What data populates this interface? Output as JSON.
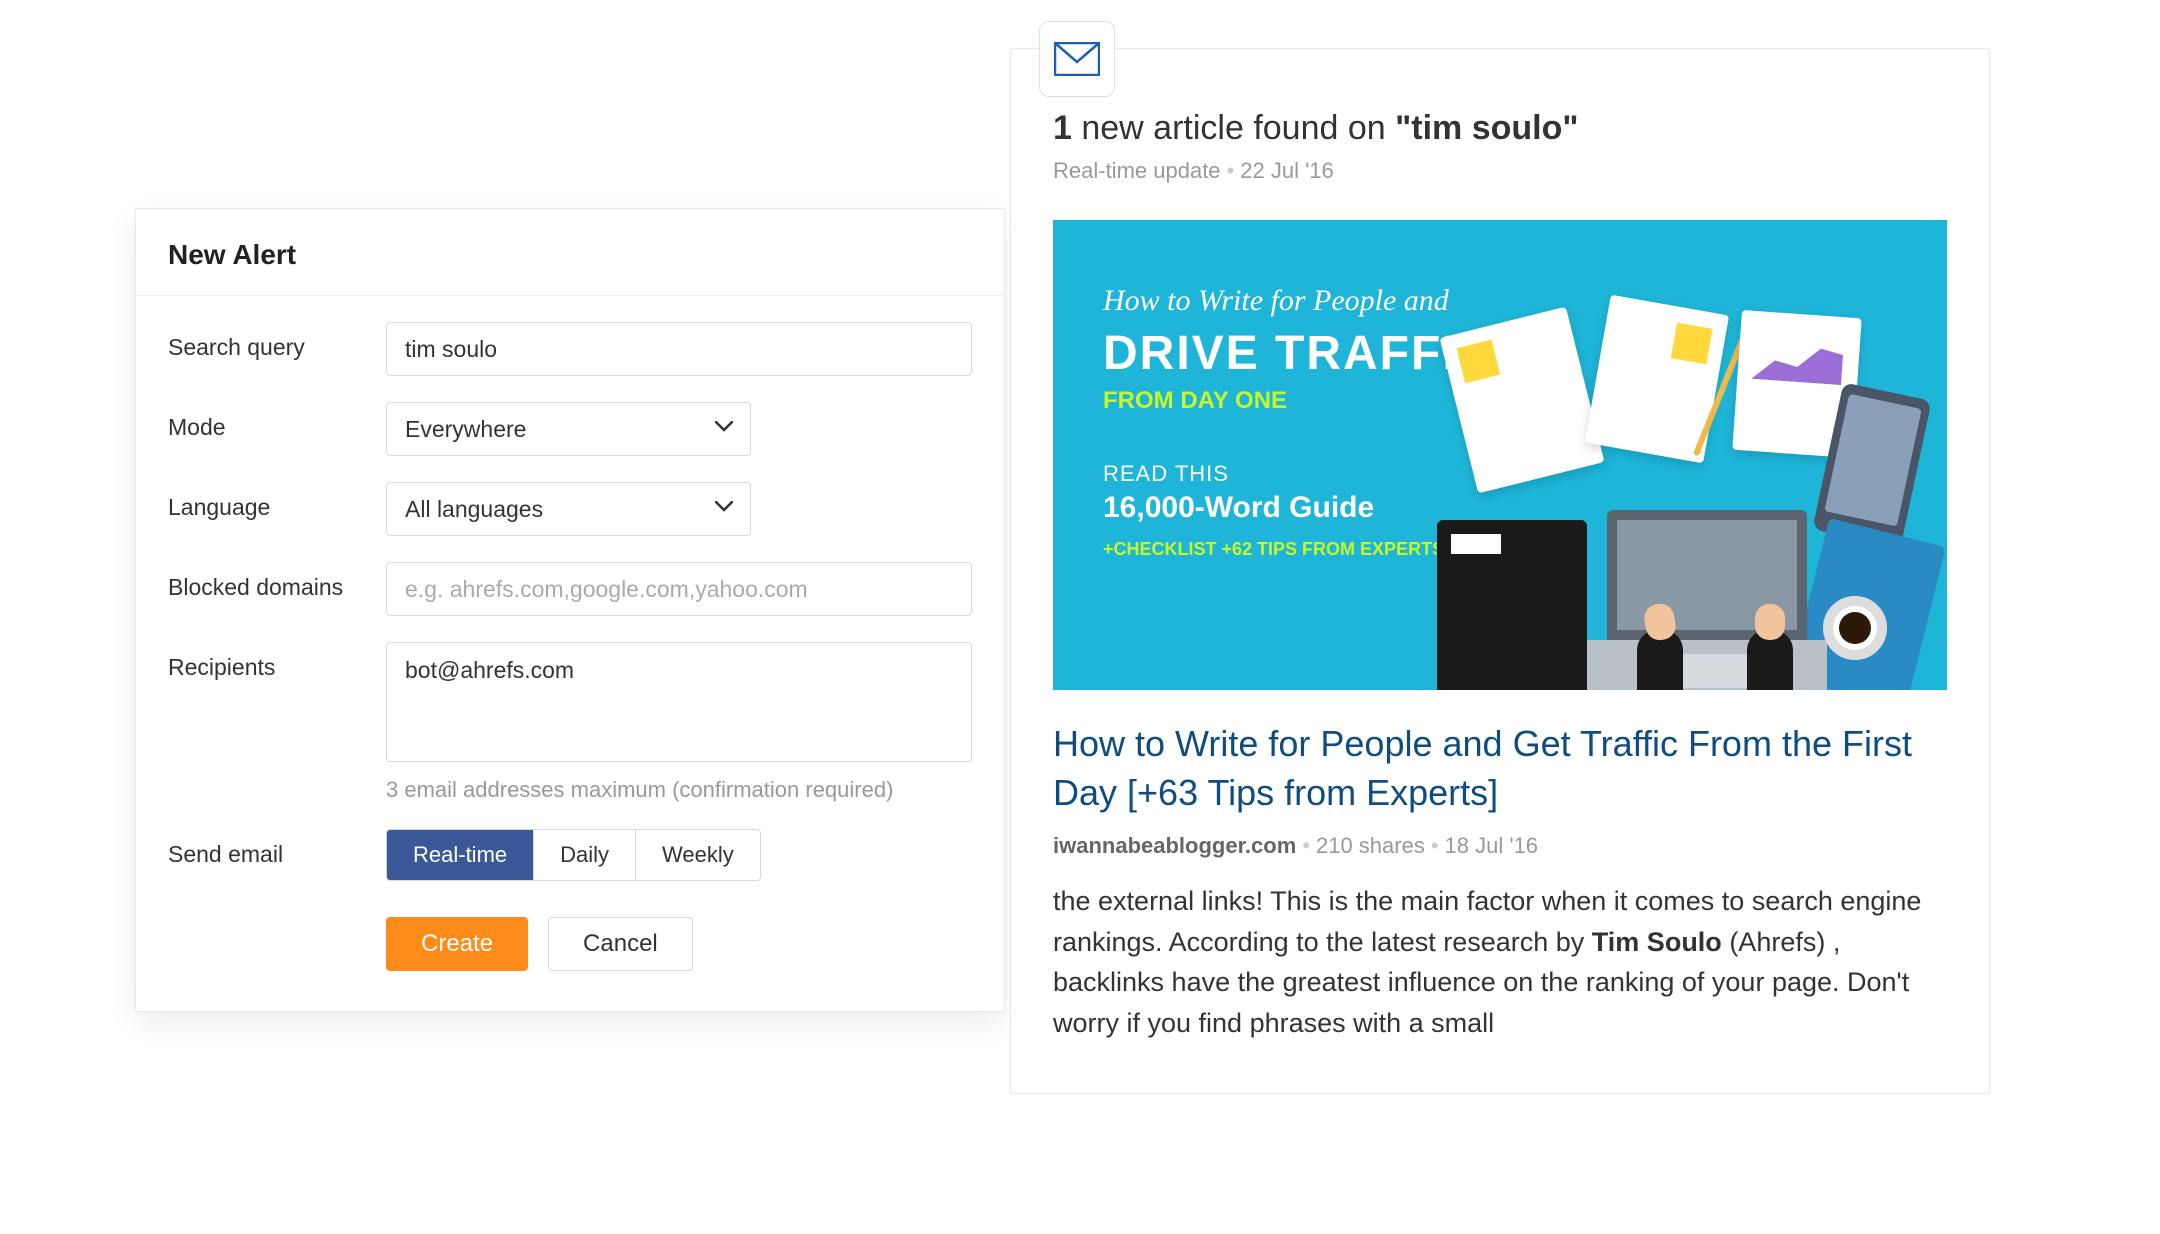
{
  "form": {
    "title": "New Alert",
    "labels": {
      "search_query": "Search query",
      "mode": "Mode",
      "language": "Language",
      "blocked_domains": "Blocked domains",
      "recipients": "Recipients",
      "send_email": "Send email"
    },
    "values": {
      "search_query": "tim soulo",
      "mode": "Everywhere",
      "language": "All languages",
      "blocked_domains": "",
      "recipients": "bot@ahrefs.com"
    },
    "placeholders": {
      "blocked_domains": "e.g. ahrefs.com,google.com,yahoo.com"
    },
    "recipients_helper": "3 email addresses maximum (confirmation required)",
    "send_email_options": {
      "realtime": "Real-time",
      "daily": "Daily",
      "weekly": "Weekly"
    },
    "send_email_selected": "realtime",
    "buttons": {
      "create": "Create",
      "cancel": "Cancel"
    }
  },
  "email": {
    "count": "1",
    "title_middle": " new article found on ",
    "query_display": "\"tim soulo\"",
    "subtitle_type": "Real-time update",
    "subtitle_date": "22 Jul '16",
    "hero": {
      "script": "How to Write for People and",
      "drive": "DRIVE TRAFFIC",
      "fromday": "FROM DAY ONE",
      "read": "READ THIS",
      "guide": "16,000-Word Guide",
      "checklist": "+CHECKLIST +62 TIPS FROM EXPERTS"
    },
    "article": {
      "title": "How to Write for People and Get Traffic From the First Day [+63 Tips from Experts]",
      "domain": "iwannabeablogger.com",
      "shares": "210 shares",
      "date": "18 Jul '16",
      "excerpt_pre": "the external links! This is the main factor when it comes to search engine rankings. According to the latest research by ",
      "excerpt_bold": "Tim Soulo",
      "excerpt_post": " (Ahrefs) , backlinks have the greatest influence on the ranking of your page. Don't worry if you find phrases with a small"
    }
  },
  "colors": {
    "primary_orange": "#ff8c1a",
    "seg_active": "#3b5998",
    "link_blue": "#0f4c81",
    "hero_bg": "#1eb5d8",
    "hero_accent": "#c5f82a"
  }
}
